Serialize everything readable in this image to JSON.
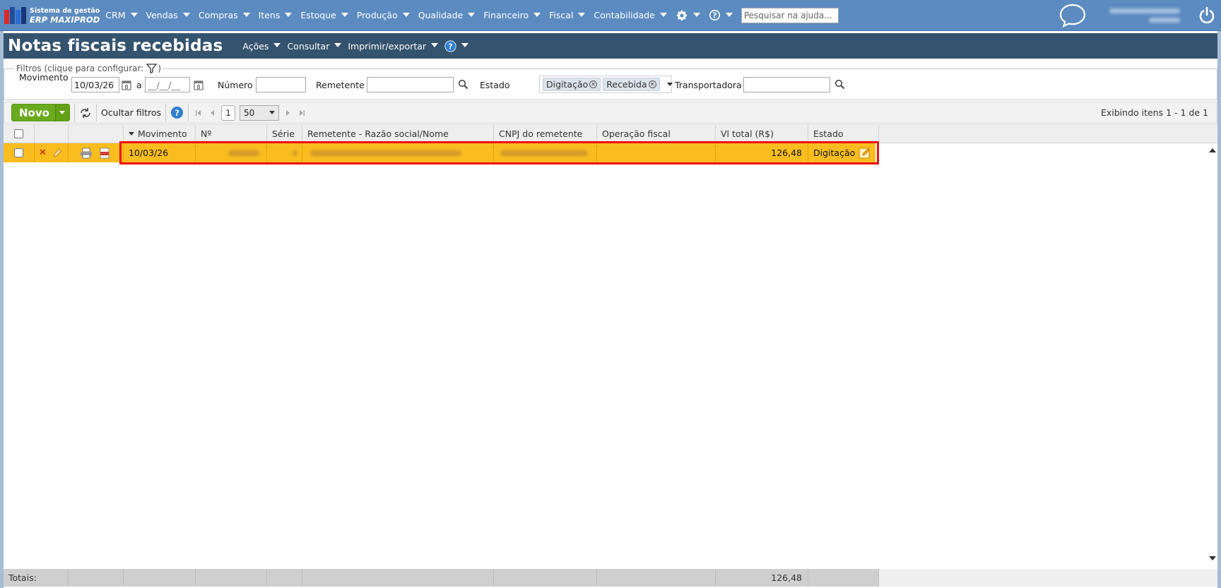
{
  "app": {
    "logo_line1": "Sistema de gestão",
    "logo_line2": "ERP MAXIPROD",
    "menu": [
      "CRM",
      "Vendas",
      "Compras",
      "Itens",
      "Estoque",
      "Produção",
      "Qualidade",
      "Financeiro",
      "Fiscal",
      "Contabilidade"
    ],
    "help_search_placeholder": "Pesquisar na ajuda..."
  },
  "page": {
    "title": "Notas fiscais recebidas",
    "actions": [
      "Ações",
      "Consultar",
      "Imprimir/exportar"
    ]
  },
  "filters": {
    "legend": "Filtros (clique para configurar:",
    "legend_close": ")",
    "movimento_label": "Movimento",
    "movimento_from": "10/03/26",
    "range_sep": "a",
    "movimento_to_placeholder": "__/__/__",
    "numero_label": "Número",
    "remetente_label": "Remetente",
    "estado_label": "Estado",
    "estado_tags": [
      "Digitação",
      "Recebida"
    ],
    "transportadora_label": "Transportadora"
  },
  "toolbar": {
    "new_label": "Novo",
    "hide_filters_label": "Ocultar filtros",
    "page_number": "1",
    "page_size": "50",
    "showing": "Exibindo itens 1 - 1 de 1"
  },
  "grid": {
    "columns": [
      "Movimento",
      "Nº",
      "Série",
      "Remetente - Razão social/Nome",
      "CNPJ do remetente",
      "Operação fiscal",
      "Vl total (R$)",
      "Estado"
    ],
    "rows": [
      {
        "movimento": "10/03/26",
        "total": "126,48",
        "estado": "Digitação"
      }
    ],
    "totals_label": "Totais:",
    "totals_value": "126,48"
  },
  "colors": {
    "topbar": "#5b8bc0",
    "titlebar": "#34536f",
    "selected_row": "#f9bd1f",
    "highlight": "#ee1111",
    "new_button": "#6aaa1e"
  }
}
